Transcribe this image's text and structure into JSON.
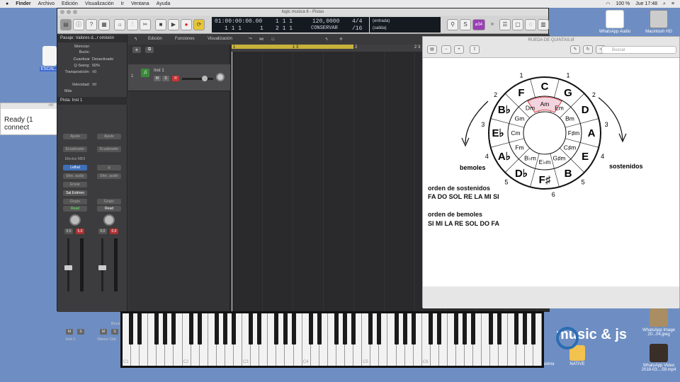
{
  "menubar": {
    "app": "Finder",
    "items": [
      "Archivo",
      "Edición",
      "Visualización",
      "Ir",
      "Ventana",
      "Ayuda"
    ],
    "battery": "100 %",
    "clock": "Jue 17:48"
  },
  "desktop": {
    "top_right_icons": [
      {
        "label": "WhatsApp Audio"
      },
      {
        "label": "Macintosh HD"
      }
    ],
    "left_icon": {
      "label": "ESCAL..."
    },
    "bottom_right_icons": [
      {
        "label": "WhatsApp Image 20...04.jpeg"
      },
      {
        "label": "WhatsApp Video 2018-03....59.mp4"
      },
      {
        "label": "seguridad maxima"
      },
      {
        "label": "NATIVE"
      }
    ],
    "logo_text": "music & js"
  },
  "ready_window": {
    "title": "vM",
    "text": "Ready (1 connect"
  },
  "logic": {
    "title": "logic musica 8 - Pistas",
    "lcd": {
      "time": "01:00:00:00.00",
      "pos1": "1 1 1",
      "pos1b": "1",
      "bars": "1 1 1",
      "bars2": "2 1 1",
      "tempo": "120,0000",
      "tempo_mode": "CONSERVAR",
      "sig": "4/4",
      "div": "/16",
      "in_label": "(entrada)",
      "out_label": "(salida)",
      "badge": "⌀34"
    },
    "inspector": {
      "region_header": "Pasaje:  Valores d...r omisión",
      "rows": [
        {
          "k": "Silenciar:",
          "v": ""
        },
        {
          "k": "Bucle:",
          "v": ""
        },
        {
          "k": "Cuantizar",
          "v": "Desactivado"
        },
        {
          "k": "Q-Swing:",
          "v": "50%"
        },
        {
          "k": "Transposición:",
          "v": "±0"
        },
        {
          "k": "Velocidad:",
          "v": "±0"
        }
      ],
      "more": "Más",
      "track_header": "Pista:  Inst 1",
      "strip1": {
        "setting": "Ajuste",
        "eq": "Ecualizador",
        "midi_fx": "Efectos MIDI",
        "instrument": "Lethal",
        "audio_fx": "Efec. audio",
        "send": "Enviar",
        "output": "Sal.Estéreo",
        "group": "Grupo",
        "automation": "Read",
        "val1": "0,0",
        "val2": "5,0",
        "name": "Inst 1"
      },
      "strip2": {
        "setting": "Ajuste",
        "eq": "Ecualizador",
        "audio_fx": "Efec. audio",
        "group": "Grupo",
        "automation": "Read",
        "val1": "0,0",
        "val2": "0,0",
        "bnce": "Bnce",
        "name": "Stereo Out"
      }
    },
    "track_toolbar": [
      "Edición",
      "Funciones",
      "Visualización"
    ],
    "track": {
      "number": "1",
      "name": "Inst 1"
    },
    "ruler": {
      "m1": "1",
      "m13": "1 3",
      "m2": "2",
      "m23": "2 3"
    }
  },
  "keyboard": {
    "c_labels": [
      "C1",
      "C2",
      "C3",
      "C4",
      "C5",
      "C6"
    ]
  },
  "preview": {
    "title": "RUEDA DE QUINTAS.tif",
    "search_placeholder": "Buscar",
    "circle": {
      "outer": [
        "C",
        "G",
        "D",
        "A",
        "E",
        "B",
        "F♯",
        "D♭",
        "A♭",
        "E♭",
        "B♭",
        "F"
      ],
      "numbers_right": [
        "1",
        "2",
        "3",
        "4",
        "5",
        "6"
      ],
      "numbers_left": [
        "1",
        "2",
        "3",
        "4",
        "5"
      ],
      "minors": [
        "Am",
        "Em",
        "Bm",
        "F♯m",
        "C♯m",
        "G♯m",
        "E♭m",
        "B♭m",
        "Fm",
        "Cm",
        "Gm",
        "Dm"
      ],
      "left_label": "bemoles",
      "right_label": "sostenidos"
    },
    "text": {
      "sharps_title": "orden de sostenidos",
      "sharps": "FA DO SOL RE LA MI SI",
      "flats_title": "orden de bemoles",
      "flats": "SI MI LA RE SOL DO FA"
    }
  }
}
